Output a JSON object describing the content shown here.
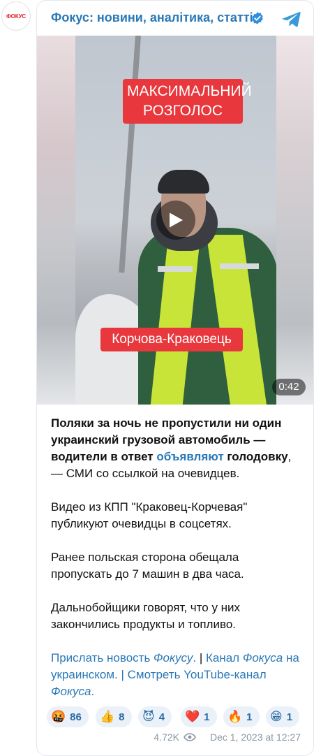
{
  "channel": {
    "avatar_text": "ФОКУС",
    "name": "Фокус: новини, аналітика, статті"
  },
  "video": {
    "caption_top": "МАКСИМАЛЬНИЙ РОЗГОЛОС",
    "caption_bottom": "Корчова-Краковець",
    "duration": "0:42"
  },
  "post": {
    "lead_part1": "Поляки за ночь не пропустили ни один украинский грузовой автомобиль — водители в ответ ",
    "lead_link": "объявляют",
    "lead_part2": " голодовку",
    "lead_tail": ", — СМИ со ссылкой на очевидцев.",
    "p2": "Видео из КПП \"Краковец-Корчевая\" публикуют очевидцы в соцсетях.",
    "p3": "Ранее польская сторона обещала пропускать до 7 машин в два часа.",
    "p4": "Дальнобойщики говорят, что у них закончились продукты и топливо.",
    "links": {
      "l1": "Прислать новость ",
      "l1_it": "Фокусу",
      "l1_end": ".",
      "sep1": " | ",
      "l2": "Канал ",
      "l2_it": "Фокуса",
      "l2_end": " на украинском.",
      "sep2": " | ",
      "l3": "Смотреть YouTube-канал ",
      "l3_it": "Фокуса",
      "l3_end": "."
    }
  },
  "reactions": [
    {
      "emoji": "🤬",
      "count": "86"
    },
    {
      "emoji": "👍",
      "count": "8"
    },
    {
      "emoji": "😈",
      "count": "4"
    },
    {
      "emoji": "❤️",
      "count": "1"
    },
    {
      "emoji": "🔥",
      "count": "1"
    },
    {
      "emoji": "😁",
      "count": "1"
    }
  ],
  "footer": {
    "views": "4.72K",
    "date": "Dec 1, 2023 at 12:27"
  },
  "colors": {
    "link": "#2a78b6",
    "badge_red": "#e8383d",
    "reaction_bg": "#eaf1f8"
  },
  "icons": {
    "verified": "verified-check-icon",
    "telegram": "telegram-plane-icon",
    "play": "play-icon",
    "views": "eye-icon"
  }
}
